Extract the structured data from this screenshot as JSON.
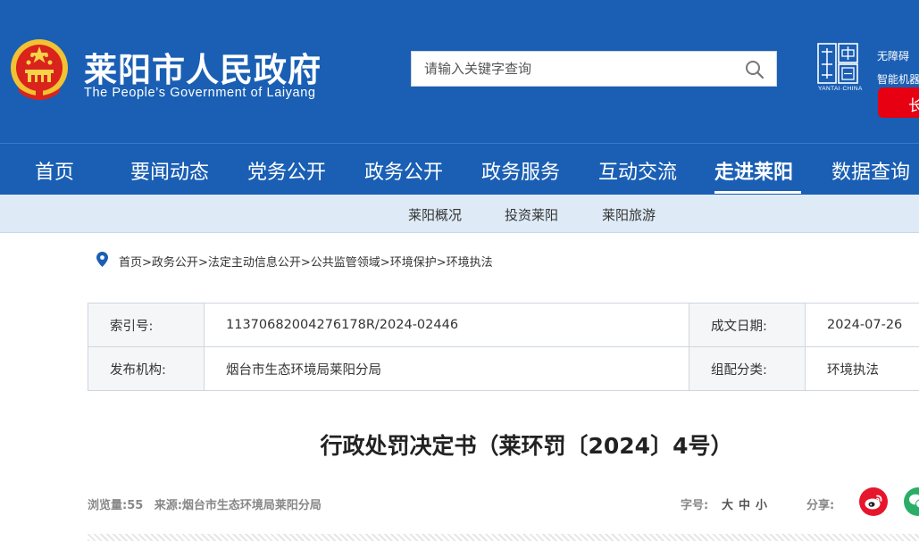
{
  "header": {
    "site_title": "莱阳市人民政府",
    "site_subtitle": "The People’s Government of Laiyang",
    "search_placeholder": "请输入关键字查询",
    "accessibility_link": "无障碍",
    "robot_link": "智能机器人",
    "red_button_label": "长",
    "yantai_logo_caption": "YANTAI·CHINA",
    "brand_color": "#1a5fb4",
    "accent_red": "#e60012"
  },
  "nav": {
    "items": [
      "首页",
      "要闻动态",
      "党务公开",
      "政务公开",
      "政务服务",
      "互动交流",
      "走进莱阳",
      "数据查询"
    ],
    "active": "走进莱阳"
  },
  "subnav": {
    "items": [
      "莱阳概况",
      "投资莱阳",
      "莱阳旅游"
    ]
  },
  "breadcrumb": {
    "items": [
      "首页",
      "政务公开",
      "法定主动信息公开",
      "公共监管领域",
      "环境保护",
      "环境执法"
    ],
    "separator": ">"
  },
  "meta": {
    "index_label": "索引号:",
    "index_value": "11370682004276178R/2024-02446",
    "date_label": "成文日期:",
    "date_value": "2024-07-26",
    "org_label": "发布机构:",
    "org_value": "烟台市生态环境局莱阳分局",
    "category_label": "组配分类:",
    "category_value": "环境执法"
  },
  "document": {
    "title": "行政处罚决定书（莱环罚〔2024〕4号）",
    "views_label": "浏览量:",
    "views_count": "55",
    "source_label": "来源:",
    "source_value": "烟台市生态环境局莱阳分局",
    "font_size_label": "字号:",
    "font_size_options": [
      "大",
      "中",
      "小"
    ],
    "share_label": "分享:",
    "share_targets": [
      "weibo-icon",
      "wechat-icon"
    ]
  }
}
